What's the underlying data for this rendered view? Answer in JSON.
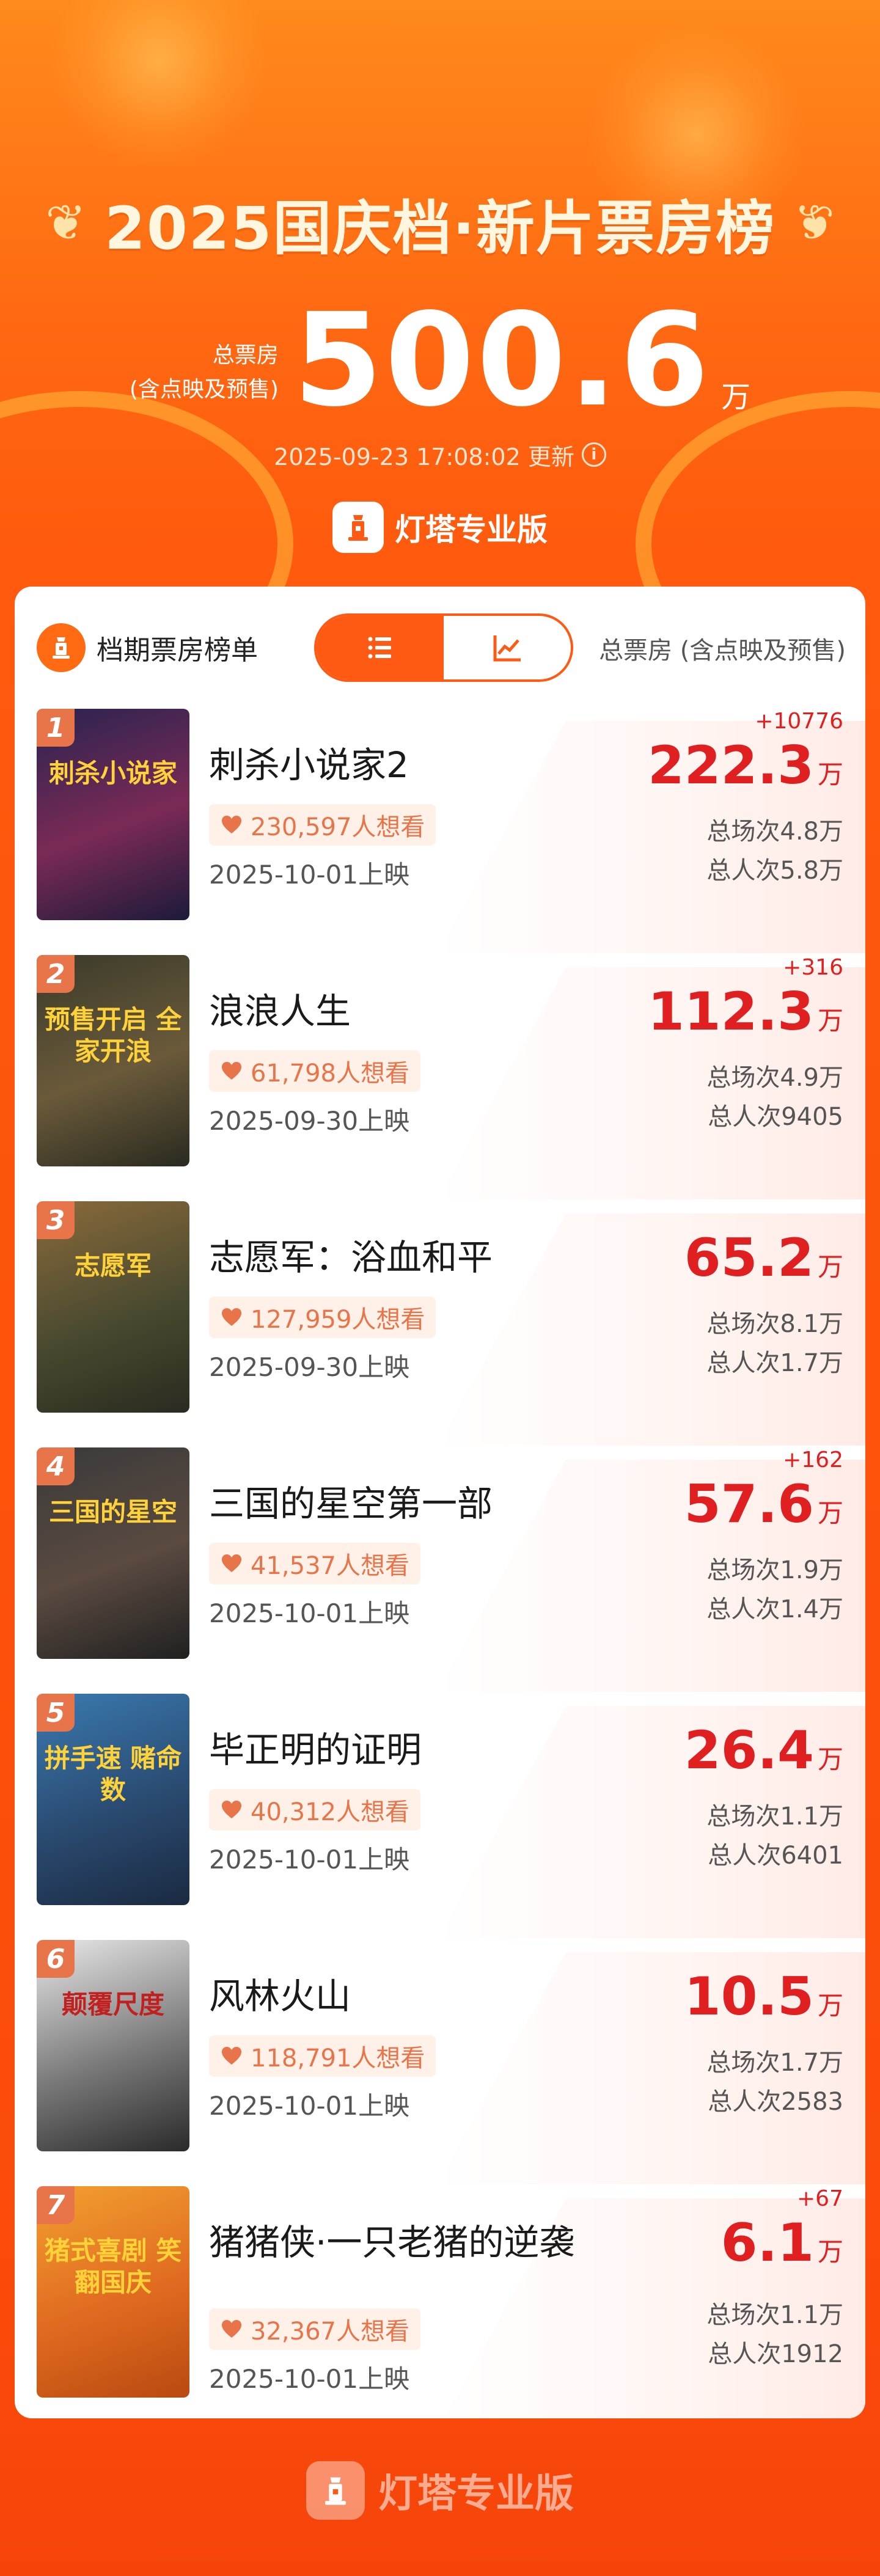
{
  "header": {
    "title": "2025国庆档·新片票房榜",
    "total_label_line1": "总票房",
    "total_label_line2": "(含点映及预售)",
    "total_value": "500.6",
    "total_unit": "万",
    "update_time": "2025-09-23 17:08:02 更新",
    "brand": "灯塔专业版"
  },
  "card": {
    "schedule_label": "档期票房榜单",
    "toggle": [
      {
        "icon": "list-icon",
        "active": true
      },
      {
        "icon": "trend-chart-icon",
        "active": false
      }
    ],
    "column_label": "总票房 (含点映及预售)"
  },
  "movies": [
    {
      "rank": "1",
      "title": "刺杀小说家2",
      "want": "230,597人想看",
      "release": "2025-10-01上映",
      "delta": "+10776",
      "box_office": "222.3",
      "unit": "万",
      "screenings": "总场次4.8万",
      "admissions": "总人次5.8万",
      "poster_text": "刺杀小说家",
      "poster_colors": [
        "#2a2350",
        "#7a2a55",
        "#1c1a3a"
      ]
    },
    {
      "rank": "2",
      "title": "浪浪人生",
      "want": "61,798人想看",
      "release": "2025-09-30上映",
      "delta": "+316",
      "box_office": "112.3",
      "unit": "万",
      "screenings": "总场次4.9万",
      "admissions": "总人次9405",
      "poster_text": "预售开启 全家开浪",
      "poster_colors": [
        "#3a3a2a",
        "#6a5a3a",
        "#2a2a20"
      ]
    },
    {
      "rank": "3",
      "title": "志愿军：浴血和平",
      "want": "127,959人想看",
      "release": "2025-09-30上映",
      "delta": "",
      "box_office": "65.2",
      "unit": "万",
      "screenings": "总场次8.1万",
      "admissions": "总人次1.7万",
      "poster_text": "志愿军",
      "poster_colors": [
        "#8a6a3a",
        "#4a4a30",
        "#2a2a20"
      ]
    },
    {
      "rank": "4",
      "title": "三国的星空第一部",
      "want": "41,537人想看",
      "release": "2025-10-01上映",
      "delta": "+162",
      "box_office": "57.6",
      "unit": "万",
      "screenings": "总场次1.9万",
      "admissions": "总人次1.4万",
      "poster_text": "三国的星空",
      "poster_colors": [
        "#3a3a3a",
        "#5a4a40",
        "#202020"
      ]
    },
    {
      "rank": "5",
      "title": "毕正明的证明",
      "want": "40,312人想看",
      "release": "2025-10-01上映",
      "delta": "",
      "box_office": "26.4",
      "unit": "万",
      "screenings": "总场次1.1万",
      "admissions": "总人次6401",
      "poster_text": "拼手速 赌命数",
      "poster_colors": [
        "#3a7ab0",
        "#2a4a70",
        "#1a2a40"
      ]
    },
    {
      "rank": "6",
      "title": "风林火山",
      "want": "118,791人想看",
      "release": "2025-10-01上映",
      "delta": "",
      "box_office": "10.5",
      "unit": "万",
      "screenings": "总场次1.7万",
      "admissions": "总人次2583",
      "poster_text": "颠覆尺度",
      "poster_colors": [
        "#e8e8e8",
        "#7a7a7a",
        "#2a2a2a"
      ]
    },
    {
      "rank": "7",
      "title": "猪猪侠·一只老猪的逆袭",
      "want": "32,367人想看",
      "release": "2025-10-01上映",
      "delta": "+67",
      "box_office": "6.1",
      "unit": "万",
      "screenings": "总场次1.1万",
      "admissions": "总人次1912",
      "poster_text": "猪式喜剧 笑翻国庆",
      "poster_colors": [
        "#f2a030",
        "#e06a20",
        "#b84a10"
      ]
    }
  ],
  "footer": {
    "brand": "灯塔专业版"
  }
}
